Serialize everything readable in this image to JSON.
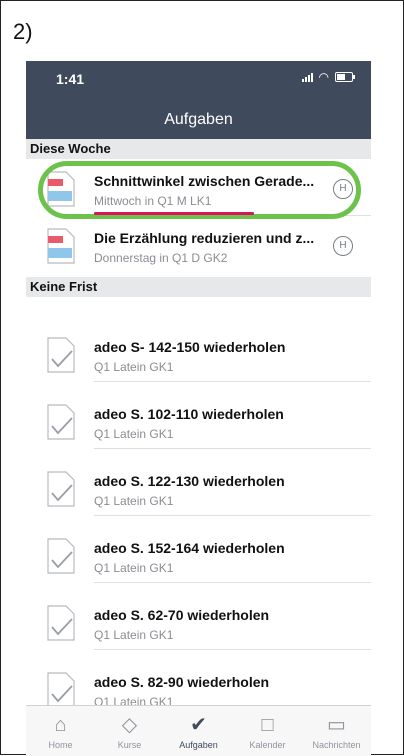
{
  "step_label": "2)",
  "status": {
    "time": "1:41"
  },
  "header": {
    "title": "Aufgaben"
  },
  "sections": [
    {
      "title": "Diese Woche",
      "items": [
        {
          "title": "Schnittwinkel zwischen Gerade...",
          "subtitle": "Mittwoch in Q1 M LK1",
          "badge": "H",
          "icon": "document-icon"
        },
        {
          "title": "Die Erzählung reduzieren und z...",
          "subtitle": "Donnerstag in Q1 D GK2",
          "badge": "H",
          "icon": "document-icon"
        }
      ]
    },
    {
      "title": "Keine Frist",
      "items": [
        {
          "title": "adeo S- 142-150 wiederholen",
          "subtitle": "Q1 Latein GK1",
          "icon": "checked-document-icon"
        },
        {
          "title": "adeo S. 102-110 wiederholen",
          "subtitle": "Q1 Latein GK1",
          "icon": "checked-document-icon"
        },
        {
          "title": "adeo S. 122-130 wiederholen",
          "subtitle": "Q1 Latein GK1",
          "icon": "checked-document-icon"
        },
        {
          "title": "adeo S. 152-164 wiederholen",
          "subtitle": "Q1 Latein GK1",
          "icon": "checked-document-icon"
        },
        {
          "title": "adeo S. 62-70 wiederholen",
          "subtitle": "Q1 Latein GK1",
          "icon": "checked-document-icon"
        },
        {
          "title": "adeo S. 82-90 wiederholen",
          "subtitle": "Q1 Latein GK1",
          "icon": "checked-document-icon"
        }
      ]
    }
  ],
  "tabbar": [
    {
      "label": "Home",
      "icon": "home-icon",
      "active": false
    },
    {
      "label": "Kurse",
      "icon": "graduation-cap-icon",
      "active": false
    },
    {
      "label": "Aufgaben",
      "icon": "checkmark-icon",
      "active": true
    },
    {
      "label": "Kalender",
      "icon": "calendar-icon",
      "active": false
    },
    {
      "label": "Nachrichten",
      "icon": "chat-bubble-icon",
      "active": false
    }
  ],
  "colors": {
    "header_bg": "#3f4a5c",
    "highlight": "#6cc24a",
    "underline": "#d8145a",
    "section_bg": "#e7e8ea"
  }
}
